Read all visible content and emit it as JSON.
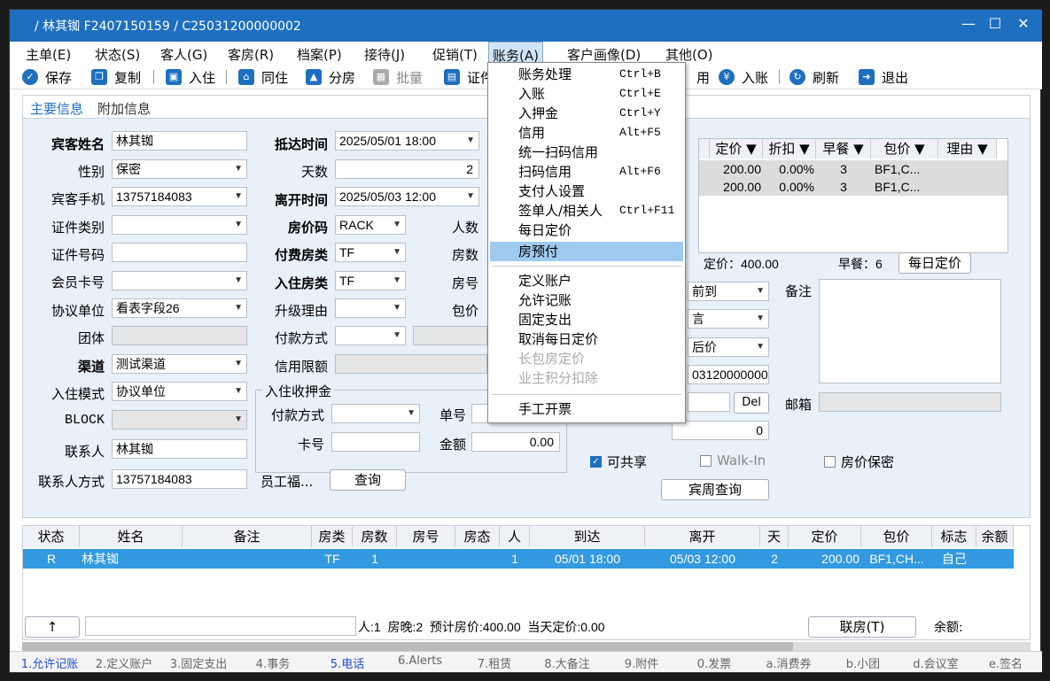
{
  "title": "/ 林其铷 F2407150159 / C25031200000002",
  "menubar": [
    "主单(E)",
    "状态(S)",
    "客人(G)",
    "客房(R)",
    "档案(P)",
    "接待(J)",
    "促销(T)",
    "账务(A)",
    "客户画像(D)",
    "其他(O)"
  ],
  "toolbar": {
    "save": "保存",
    "copy": "复制",
    "checkin": "入住",
    "samehouse": "同住",
    "split": "分房",
    "batch": "批量",
    "cert": "证件",
    "use": "用",
    "post": "入账",
    "refresh": "刷新",
    "exit": "退出"
  },
  "tabs": {
    "main": "主要信息",
    "extra": "附加信息"
  },
  "form": {
    "guest_name_l": "宾客姓名",
    "guest_name": "林其铷",
    "gender_l": "性别",
    "gender": "保密",
    "phone_l": "宾客手机",
    "phone": "13757184083",
    "cert_type_l": "证件类别",
    "cert_no_l": "证件号码",
    "member_l": "会员卡号",
    "agreement_l": "协议单位",
    "agreement": "看表字段26",
    "group_l": "团体",
    "channel_l": "渠道",
    "channel": "测试渠道",
    "mode_l": "入住模式",
    "mode": "协议单位",
    "block_l": "BLOCK",
    "contact_l": "联系人",
    "contact": "林其铷",
    "contact_way_l": "联系人方式",
    "contact_way": "13757184083",
    "arrive_l": "抵达时间",
    "arrive": "2025/05/01 18:00",
    "days_l": "天数",
    "days": "2",
    "leave_l": "离开时间",
    "leave": "2025/05/03 12:00",
    "ratecode_l": "房价码",
    "ratecode": "RACK",
    "paytype_l": "付费房类",
    "paytype": "TF",
    "roomtype_l": "入住房类",
    "roomtype": "TF",
    "upgrade_l": "升级理由",
    "paymethod_l": "付款方式",
    "credit_l": "信用限额",
    "persons_l": "人数",
    "rooms_l": "房数",
    "roomno_l": "房号",
    "pkg_l": "包价",
    "deposit_title": "入住收押金",
    "dep_pay_l": "付款方式",
    "dep_no_l": "单号",
    "dep_card_l": "卡号",
    "dep_amount_l": "金额",
    "dep_amount": "0.00",
    "staff": "员工福...",
    "query": "查询",
    "arrive_status": "前到",
    "credit_status": "言",
    "rate_status": "后价",
    "order_no": "03120000000",
    "del": "Del",
    "zero": "0",
    "remark_l": "备注",
    "email_l": "邮箱",
    "share": "可共享",
    "walkin": "Walk-In",
    "privacy": "房价保密",
    "weekquery": "宾周查询",
    "fixedprice_text": "定价：400.00",
    "breakfast_text": "早餐：6",
    "dailyprice_btn": "每日定价"
  },
  "rategrid": {
    "headers": [
      "定价 ▼",
      "折扣 ▼",
      "早餐 ▼",
      "包价 ▼",
      "理由 ▼"
    ],
    "rows": [
      [
        "200.00",
        "0.00%",
        "3",
        "BF1,C..."
      ],
      [
        "200.00",
        "0.00%",
        "3",
        "BF1,C..."
      ]
    ]
  },
  "dropdown": {
    "items": [
      {
        "label": "账务处理",
        "key": "Ctrl+B"
      },
      {
        "label": "入账",
        "key": "Ctrl+E"
      },
      {
        "label": "入押金",
        "key": "Ctrl+Y"
      },
      {
        "label": "信用",
        "key": "Alt+F5"
      },
      {
        "label": "统一扫码信用",
        "key": ""
      },
      {
        "label": "扫码信用",
        "key": "Alt+F6"
      },
      {
        "label": "支付人设置",
        "key": ""
      },
      {
        "label": "签单人/相关人",
        "key": "Ctrl+F11"
      },
      {
        "label": "每日定价",
        "key": ""
      },
      {
        "label": "房预付",
        "key": ""
      },
      {
        "label": "定义账户",
        "key": ""
      },
      {
        "label": "允许记账",
        "key": ""
      },
      {
        "label": "固定支出",
        "key": ""
      },
      {
        "label": "取消每日定价",
        "key": ""
      },
      {
        "label": "长包房定价",
        "key": ""
      },
      {
        "label": "业主积分扣除",
        "key": ""
      },
      {
        "label": "手工开票",
        "key": ""
      }
    ]
  },
  "lower": {
    "headers": [
      "状态",
      "姓名",
      "备注",
      "房类",
      "房数",
      "房号",
      "房态",
      "人",
      "到达",
      "离开",
      "天",
      "定价",
      "包价",
      "标志",
      "余额"
    ],
    "row": [
      "R",
      "林其铷",
      "",
      "TF",
      "1",
      "",
      "",
      "1",
      "05/01 18:00",
      "05/03 12:00",
      "2",
      "200.00",
      "BF1,CH...",
      "自己"
    ],
    "up": "↑",
    "summary": "人:1  房晚:2  预计房价:400.00  当天定价:0.00",
    "link": "联房(T)",
    "balance": "余额:"
  },
  "footer": [
    "1.允许记账",
    "2.定义账户",
    "3.固定支出",
    "4.事务",
    "5.电话",
    "6.Alerts",
    "7.租赁",
    "8.大备注",
    "9.附件",
    "0.发票",
    "a.消费券",
    "b.小团",
    "d.会议室",
    "e.签名"
  ]
}
